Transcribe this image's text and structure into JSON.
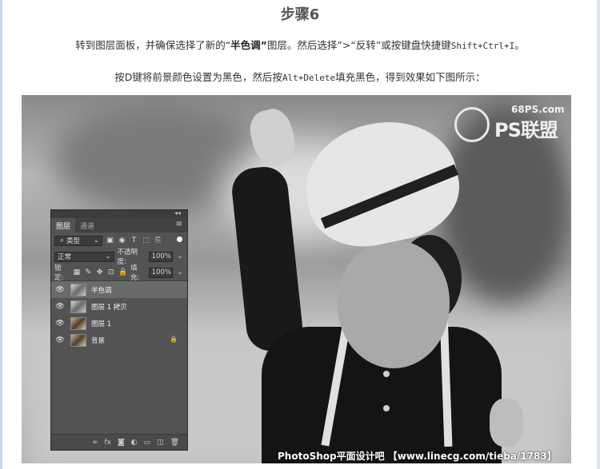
{
  "article": {
    "title": "步骤6",
    "p1": {
      "pre": "转到图层面板，并确保选择了新的“",
      "bold": "半色调”",
      "mid": "图层。然后选择”>“反转”或按键盘快捷键",
      "shortcut": "Shift+Ctrl+I",
      "end": "。"
    },
    "p2": {
      "pre": "按D键将前景颜色设置为黑色，然后按",
      "shortcut": "Alt+Delete",
      "end": "填充黑色，得到效果如下图所示："
    }
  },
  "watermarks": {
    "site": "68PS.com",
    "brand": "PS联盟",
    "footer": "PhotoShop平面设计吧 【www.linecg.com/tieba/1783】"
  },
  "layers_panel": {
    "collapse_glyph": "◂◂",
    "tabs": [
      {
        "label": "图层",
        "active": true
      },
      {
        "label": "通道",
        "active": false
      }
    ],
    "menu_icon": "≡",
    "filter": {
      "label": "类型",
      "search_icon": "⌕",
      "chevron": "⌄"
    },
    "filter_icons": [
      "▣",
      "◉",
      "T",
      "⬚",
      "⎘"
    ],
    "blend_mode": {
      "value": "正常",
      "chevron": "⌄"
    },
    "opacity": {
      "label": "不透明度:",
      "value": "100%",
      "chevron": "⌄"
    },
    "lock": {
      "label": "锁定:",
      "icons": [
        "▦",
        "✎",
        "✥",
        "⊡",
        "🔒"
      ]
    },
    "fill": {
      "label": "填充:",
      "value": "100%",
      "chevron": "⌄"
    },
    "layers": [
      {
        "name": "半色调",
        "selected": true,
        "visible": true,
        "thumb": "gray",
        "locked": false
      },
      {
        "name": "图层 1 拷贝",
        "selected": false,
        "visible": true,
        "thumb": "gray",
        "locked": false
      },
      {
        "name": "图层 1",
        "selected": false,
        "visible": true,
        "thumb": "color",
        "locked": false
      },
      {
        "name": "背景",
        "selected": false,
        "visible": true,
        "thumb": "color",
        "locked": true
      }
    ],
    "eye_glyph": "👁",
    "lock_glyph": "🔒",
    "footer_icons": [
      "∞",
      "fx",
      "◙",
      "◐",
      "▭",
      "◫",
      "🗑"
    ]
  },
  "colors": {
    "panel_bg": "#535353",
    "selected_layer": "#6a6a6a",
    "accent_rule": "#c9d6e8"
  }
}
